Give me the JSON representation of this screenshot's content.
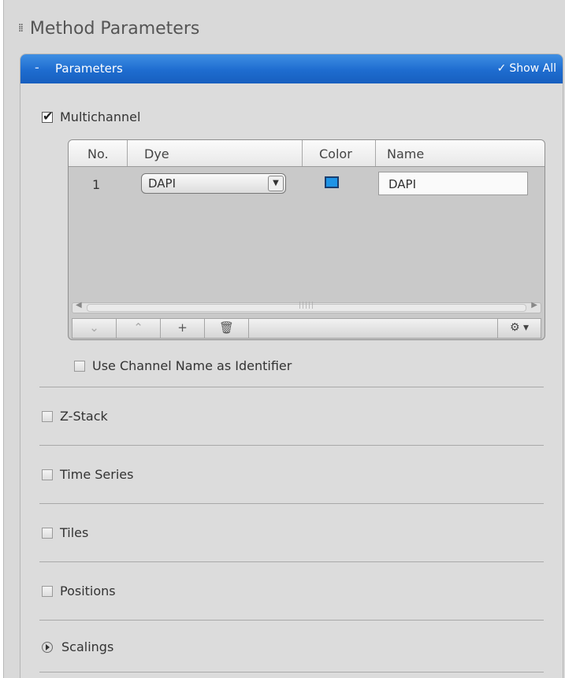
{
  "header": {
    "title": "Method Parameters",
    "grip_icon": "grip-dots-icon"
  },
  "panel": {
    "title": "Parameters",
    "collapse_glyph": "-",
    "show_all_check": "✓",
    "show_all_label": "Show All",
    "accent_color": "#1e6ccf"
  },
  "multichannel": {
    "label": "Multichannel",
    "checked": true,
    "table": {
      "headers": {
        "no": "No.",
        "dye": "Dye",
        "color": "Color",
        "name": "Name"
      },
      "rows": [
        {
          "no": "1",
          "dye": "DAPI",
          "color": "#1e94e6",
          "name": "DAPI"
        }
      ]
    },
    "toolbar": {
      "move_down": "⌄",
      "move_up": "⌃",
      "add": "+",
      "delete": "🗑",
      "options": "⚙ ▾"
    },
    "use_channel_name_label": "Use Channel Name as Identifier",
    "use_channel_name_checked": false
  },
  "options": {
    "zstack": {
      "label": "Z-Stack",
      "checked": false
    },
    "time_series": {
      "label": "Time Series",
      "checked": false
    },
    "tiles": {
      "label": "Tiles",
      "checked": false
    },
    "positions": {
      "label": "Positions",
      "checked": false
    },
    "scalings": {
      "label": "Scalings",
      "icon": "expand-arrow-icon"
    }
  }
}
